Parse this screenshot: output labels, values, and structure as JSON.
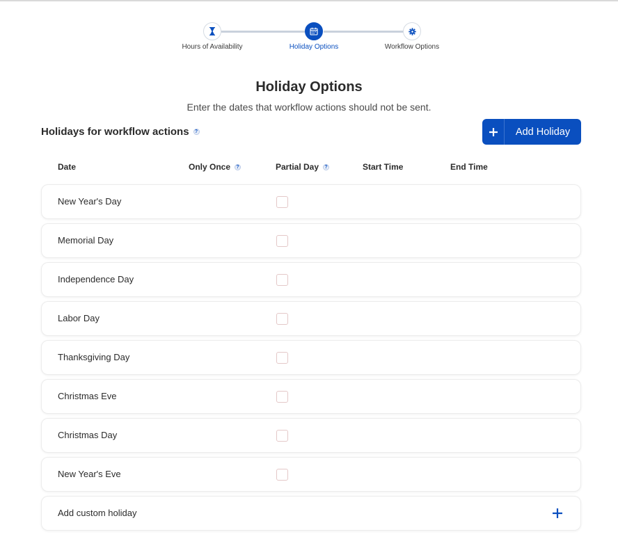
{
  "stepper": {
    "steps": [
      {
        "label": "Hours of Availability",
        "icon": "hourglass-icon",
        "active": false
      },
      {
        "label": "Holiday Options",
        "icon": "calendar-icon",
        "active": true
      },
      {
        "label": "Workflow Options",
        "icon": "gear-icon",
        "active": false
      }
    ]
  },
  "page": {
    "title": "Holiday Options",
    "subtitle": "Enter the dates that workflow actions should not be sent."
  },
  "section": {
    "title": "Holidays for workflow actions",
    "help_glyph": "?"
  },
  "add_button": {
    "label": "Add Holiday",
    "icon": "plus-icon"
  },
  "table": {
    "headers": {
      "date": "Date",
      "only_once": "Only Once",
      "partial_day": "Partial Day",
      "start_time": "Start Time",
      "end_time": "End Time"
    },
    "rows": [
      {
        "label": "New Year's Day",
        "partial_day": false
      },
      {
        "label": "Memorial Day",
        "partial_day": false
      },
      {
        "label": "Independence Day",
        "partial_day": false
      },
      {
        "label": "Labor Day",
        "partial_day": false
      },
      {
        "label": "Thanksgiving Day",
        "partial_day": false
      },
      {
        "label": "Christmas Eve",
        "partial_day": false
      },
      {
        "label": "Christmas Day",
        "partial_day": false
      },
      {
        "label": "New Year's Eve",
        "partial_day": false
      }
    ],
    "custom_row_label": "Add custom holiday"
  },
  "colors": {
    "accent": "#0a4fbf",
    "checkbox_border": "#e4c8c8",
    "step_line": "#c9d1dc"
  }
}
